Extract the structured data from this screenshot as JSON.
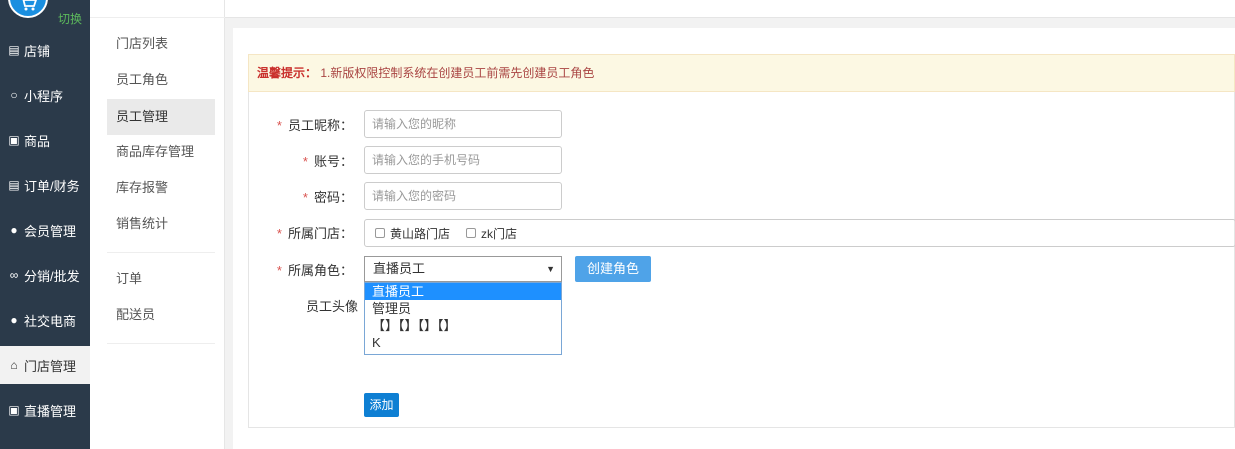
{
  "sidebar": {
    "switch_label": "切换",
    "items": [
      {
        "label": "店铺",
        "icon": "store-icon"
      },
      {
        "label": "小程序",
        "icon": "compass-icon"
      },
      {
        "label": "商品",
        "icon": "bag-icon"
      },
      {
        "label": "订单/财务",
        "icon": "document-icon"
      },
      {
        "label": "会员管理",
        "icon": "users-icon"
      },
      {
        "label": "分销/批发",
        "icon": "share-icon"
      },
      {
        "label": "社交电商",
        "icon": "chat-icon"
      },
      {
        "label": "门店管理",
        "icon": "shop-icon"
      },
      {
        "label": "直播管理",
        "icon": "bag-icon"
      }
    ]
  },
  "subnav": {
    "items": [
      "门店列表",
      "员工角色",
      "员工管理",
      "商品库存管理",
      "库存报警",
      "销售统计"
    ],
    "items2": [
      "订单",
      "配送员"
    ]
  },
  "tip": {
    "label": "温馨提示：",
    "text": "1.新版权限控制系统在创建员工前需先创建员工角色"
  },
  "form": {
    "nickname_label": "员工昵称：",
    "nickname_placeholder": "请输入您的昵称",
    "account_label": "账号：",
    "account_placeholder": "请输入您的手机号码",
    "password_label": "密码：",
    "password_placeholder": "请输入您的密码",
    "store_label": "所属门店：",
    "stores": [
      "黄山路门店",
      "zk门店"
    ],
    "role_label": "所属角色：",
    "role_selected": "直播员工",
    "role_options": [
      "直播员工",
      "管理员",
      "【】【】【】【】",
      "K"
    ],
    "create_role_label": "创建角色",
    "avatar_label": "员工头像",
    "add_label": "添加"
  },
  "colors": {
    "sidebar_bg": "#2b3a4a",
    "primary": "#0e7fd3",
    "required": "#d9534f"
  }
}
